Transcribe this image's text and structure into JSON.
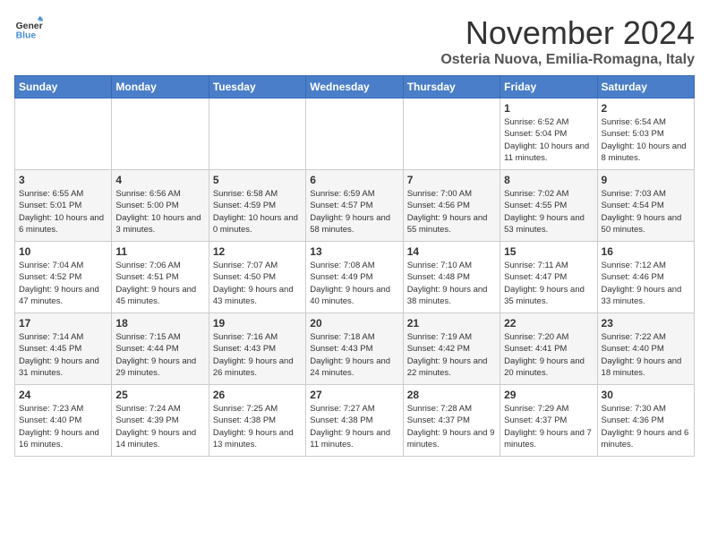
{
  "logo": {
    "line1": "General",
    "line2": "Blue"
  },
  "title": "November 2024",
  "location": "Osteria Nuova, Emilia-Romagna, Italy",
  "weekdays": [
    "Sunday",
    "Monday",
    "Tuesday",
    "Wednesday",
    "Thursday",
    "Friday",
    "Saturday"
  ],
  "weeks": [
    [
      {
        "day": "",
        "info": ""
      },
      {
        "day": "",
        "info": ""
      },
      {
        "day": "",
        "info": ""
      },
      {
        "day": "",
        "info": ""
      },
      {
        "day": "",
        "info": ""
      },
      {
        "day": "1",
        "info": "Sunrise: 6:52 AM\nSunset: 5:04 PM\nDaylight: 10 hours and 11 minutes."
      },
      {
        "day": "2",
        "info": "Sunrise: 6:54 AM\nSunset: 5:03 PM\nDaylight: 10 hours and 8 minutes."
      }
    ],
    [
      {
        "day": "3",
        "info": "Sunrise: 6:55 AM\nSunset: 5:01 PM\nDaylight: 10 hours and 6 minutes."
      },
      {
        "day": "4",
        "info": "Sunrise: 6:56 AM\nSunset: 5:00 PM\nDaylight: 10 hours and 3 minutes."
      },
      {
        "day": "5",
        "info": "Sunrise: 6:58 AM\nSunset: 4:59 PM\nDaylight: 10 hours and 0 minutes."
      },
      {
        "day": "6",
        "info": "Sunrise: 6:59 AM\nSunset: 4:57 PM\nDaylight: 9 hours and 58 minutes."
      },
      {
        "day": "7",
        "info": "Sunrise: 7:00 AM\nSunset: 4:56 PM\nDaylight: 9 hours and 55 minutes."
      },
      {
        "day": "8",
        "info": "Sunrise: 7:02 AM\nSunset: 4:55 PM\nDaylight: 9 hours and 53 minutes."
      },
      {
        "day": "9",
        "info": "Sunrise: 7:03 AM\nSunset: 4:54 PM\nDaylight: 9 hours and 50 minutes."
      }
    ],
    [
      {
        "day": "10",
        "info": "Sunrise: 7:04 AM\nSunset: 4:52 PM\nDaylight: 9 hours and 47 minutes."
      },
      {
        "day": "11",
        "info": "Sunrise: 7:06 AM\nSunset: 4:51 PM\nDaylight: 9 hours and 45 minutes."
      },
      {
        "day": "12",
        "info": "Sunrise: 7:07 AM\nSunset: 4:50 PM\nDaylight: 9 hours and 43 minutes."
      },
      {
        "day": "13",
        "info": "Sunrise: 7:08 AM\nSunset: 4:49 PM\nDaylight: 9 hours and 40 minutes."
      },
      {
        "day": "14",
        "info": "Sunrise: 7:10 AM\nSunset: 4:48 PM\nDaylight: 9 hours and 38 minutes."
      },
      {
        "day": "15",
        "info": "Sunrise: 7:11 AM\nSunset: 4:47 PM\nDaylight: 9 hours and 35 minutes."
      },
      {
        "day": "16",
        "info": "Sunrise: 7:12 AM\nSunset: 4:46 PM\nDaylight: 9 hours and 33 minutes."
      }
    ],
    [
      {
        "day": "17",
        "info": "Sunrise: 7:14 AM\nSunset: 4:45 PM\nDaylight: 9 hours and 31 minutes."
      },
      {
        "day": "18",
        "info": "Sunrise: 7:15 AM\nSunset: 4:44 PM\nDaylight: 9 hours and 29 minutes."
      },
      {
        "day": "19",
        "info": "Sunrise: 7:16 AM\nSunset: 4:43 PM\nDaylight: 9 hours and 26 minutes."
      },
      {
        "day": "20",
        "info": "Sunrise: 7:18 AM\nSunset: 4:43 PM\nDaylight: 9 hours and 24 minutes."
      },
      {
        "day": "21",
        "info": "Sunrise: 7:19 AM\nSunset: 4:42 PM\nDaylight: 9 hours and 22 minutes."
      },
      {
        "day": "22",
        "info": "Sunrise: 7:20 AM\nSunset: 4:41 PM\nDaylight: 9 hours and 20 minutes."
      },
      {
        "day": "23",
        "info": "Sunrise: 7:22 AM\nSunset: 4:40 PM\nDaylight: 9 hours and 18 minutes."
      }
    ],
    [
      {
        "day": "24",
        "info": "Sunrise: 7:23 AM\nSunset: 4:40 PM\nDaylight: 9 hours and 16 minutes."
      },
      {
        "day": "25",
        "info": "Sunrise: 7:24 AM\nSunset: 4:39 PM\nDaylight: 9 hours and 14 minutes."
      },
      {
        "day": "26",
        "info": "Sunrise: 7:25 AM\nSunset: 4:38 PM\nDaylight: 9 hours and 13 minutes."
      },
      {
        "day": "27",
        "info": "Sunrise: 7:27 AM\nSunset: 4:38 PM\nDaylight: 9 hours and 11 minutes."
      },
      {
        "day": "28",
        "info": "Sunrise: 7:28 AM\nSunset: 4:37 PM\nDaylight: 9 hours and 9 minutes."
      },
      {
        "day": "29",
        "info": "Sunrise: 7:29 AM\nSunset: 4:37 PM\nDaylight: 9 hours and 7 minutes."
      },
      {
        "day": "30",
        "info": "Sunrise: 7:30 AM\nSunset: 4:36 PM\nDaylight: 9 hours and 6 minutes."
      }
    ]
  ]
}
